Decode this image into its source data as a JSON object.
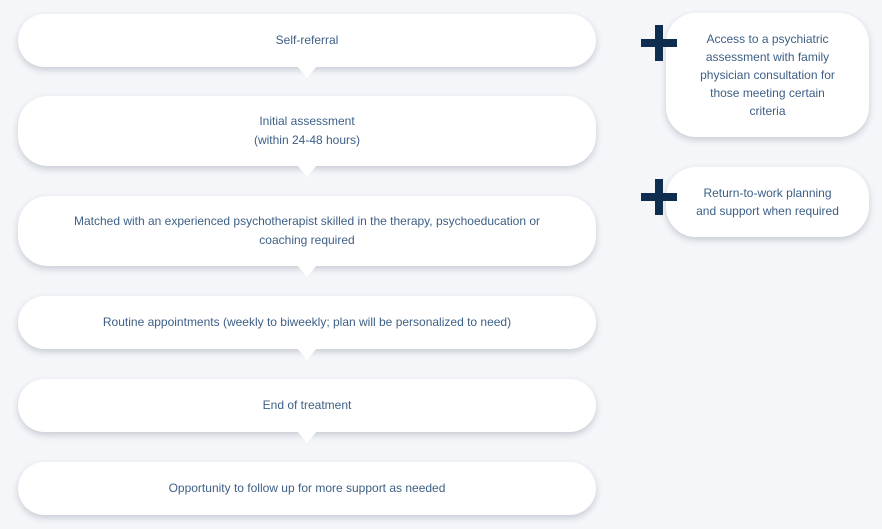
{
  "steps": [
    {
      "lines": [
        "Self-referral"
      ]
    },
    {
      "lines": [
        "Initial assessment",
        "(within 24-48 hours)"
      ]
    },
    {
      "lines": [
        "Matched with an experienced psychotherapist skilled in the therapy, psychoeducation or",
        "coaching required"
      ]
    },
    {
      "lines": [
        "Routine appointments (weekly to biweekly; plan will be personalized to need)"
      ]
    },
    {
      "lines": [
        "End of treatment"
      ]
    },
    {
      "lines": [
        "Opportunity to follow up for more support as needed"
      ]
    }
  ],
  "extras": [
    {
      "icon": "plus-icon",
      "lines": [
        "Access to a psychiatric",
        "assessment with family",
        "physician consultation for",
        "those meeting certain",
        "criteria"
      ]
    },
    {
      "icon": "plus-icon",
      "lines": [
        "Return-to-work planning",
        "and support when required"
      ]
    }
  ],
  "colors": {
    "background": "#f4f6f9",
    "box": "#ffffff",
    "text": "#3d5f86",
    "plus": "#0f2d4f"
  }
}
